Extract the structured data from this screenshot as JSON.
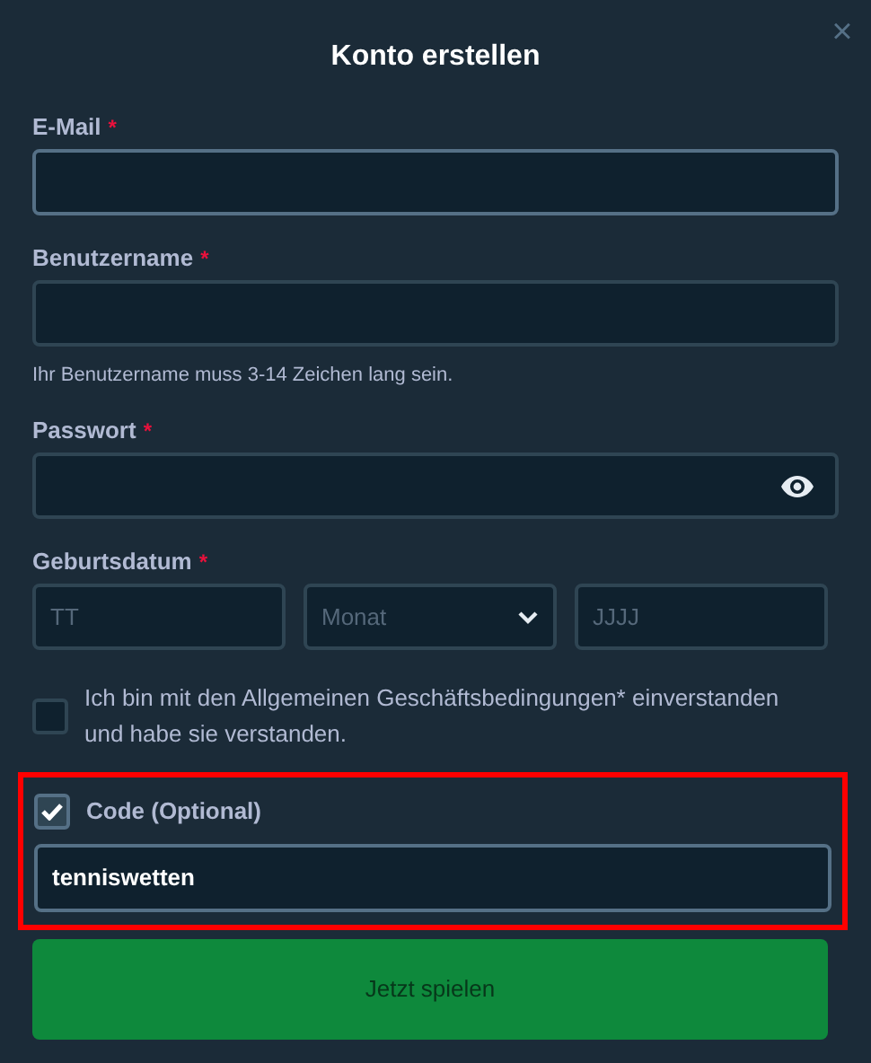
{
  "dialog": {
    "title": "Konto erstellen",
    "close": "×"
  },
  "fields": [
    {
      "kind": "text",
      "label": "E-Mail",
      "required_mark": "*",
      "focused": true
    },
    {
      "kind": "text",
      "label": "Benutzername",
      "required_mark": "*",
      "focused": false,
      "hint": "Ihr Benutzername muss 3-14 Zeichen lang sein."
    },
    {
      "kind": "password",
      "label": "Passwort",
      "required_mark": "*",
      "focused": false
    }
  ],
  "birthdate": {
    "label": "Geburtsdatum",
    "required_mark": "*",
    "day": {
      "placeholder": "TT"
    },
    "month": {
      "placeholder": "Monat"
    },
    "year": {
      "placeholder": "JJJJ"
    }
  },
  "terms": {
    "checked": false,
    "text": "Ich bin mit den Allgemeinen Geschäftsbedingungen* einverstanden und habe sie verstanden."
  },
  "code": {
    "highlighted": true,
    "checked": true,
    "label": "Code (Optional)",
    "value": "tenniswetten"
  },
  "submit": {
    "label": "Jetzt spielen"
  }
}
